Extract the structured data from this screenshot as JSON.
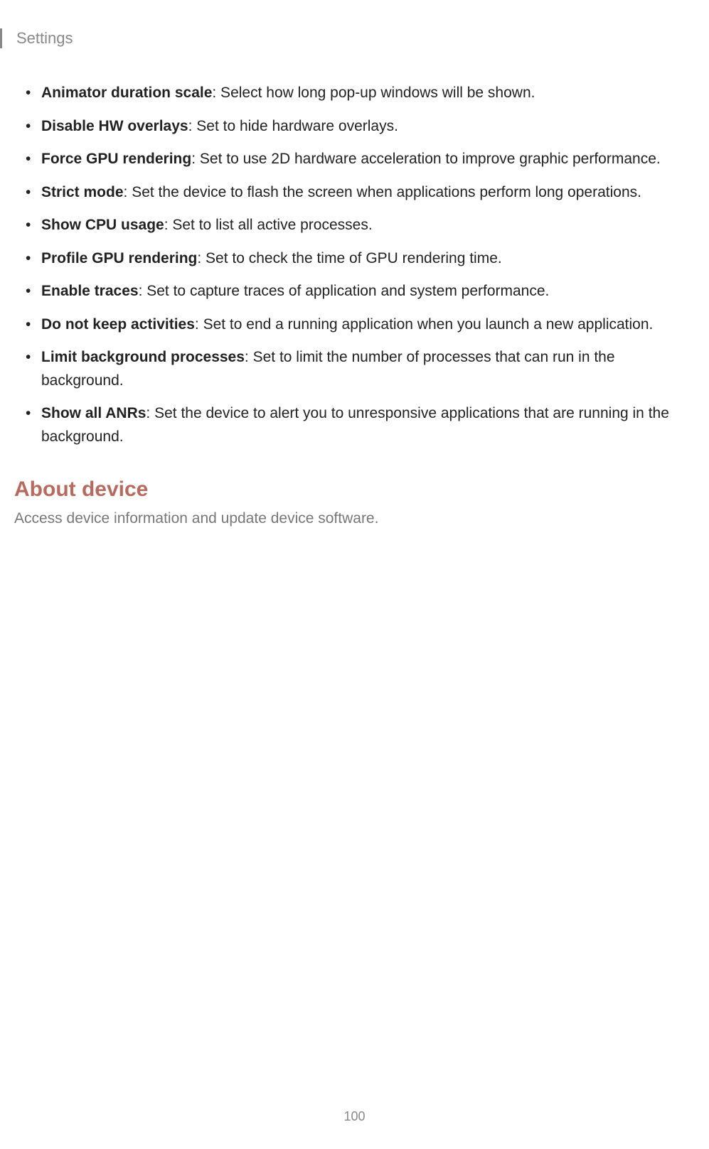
{
  "header": {
    "title": "Settings"
  },
  "items": [
    {
      "term": "Animator duration scale",
      "desc": ": Select how long pop-up windows will be shown."
    },
    {
      "term": "Disable HW overlays",
      "desc": ": Set to hide hardware overlays."
    },
    {
      "term": "Force GPU rendering",
      "desc": ": Set to use 2D hardware acceleration to improve graphic performance."
    },
    {
      "term": "Strict mode",
      "desc": ": Set the device to flash the screen when applications perform long operations."
    },
    {
      "term": "Show CPU usage",
      "desc": ": Set to list all active processes."
    },
    {
      "term": "Profile GPU rendering",
      "desc": ": Set to check the time of GPU rendering time."
    },
    {
      "term": "Enable traces",
      "desc": ": Set to capture traces of application and system performance."
    },
    {
      "term": "Do not keep activities",
      "desc": ": Set to end a running application when you launch a new application."
    },
    {
      "term": "Limit background processes",
      "desc": ": Set to limit the number of processes that can run in the background."
    },
    {
      "term": "Show all ANRs",
      "desc": ": Set the device to alert you to unresponsive applications that are running in the background."
    }
  ],
  "section": {
    "heading": "About device",
    "body": "Access device information and update device software."
  },
  "pageNumber": "100"
}
